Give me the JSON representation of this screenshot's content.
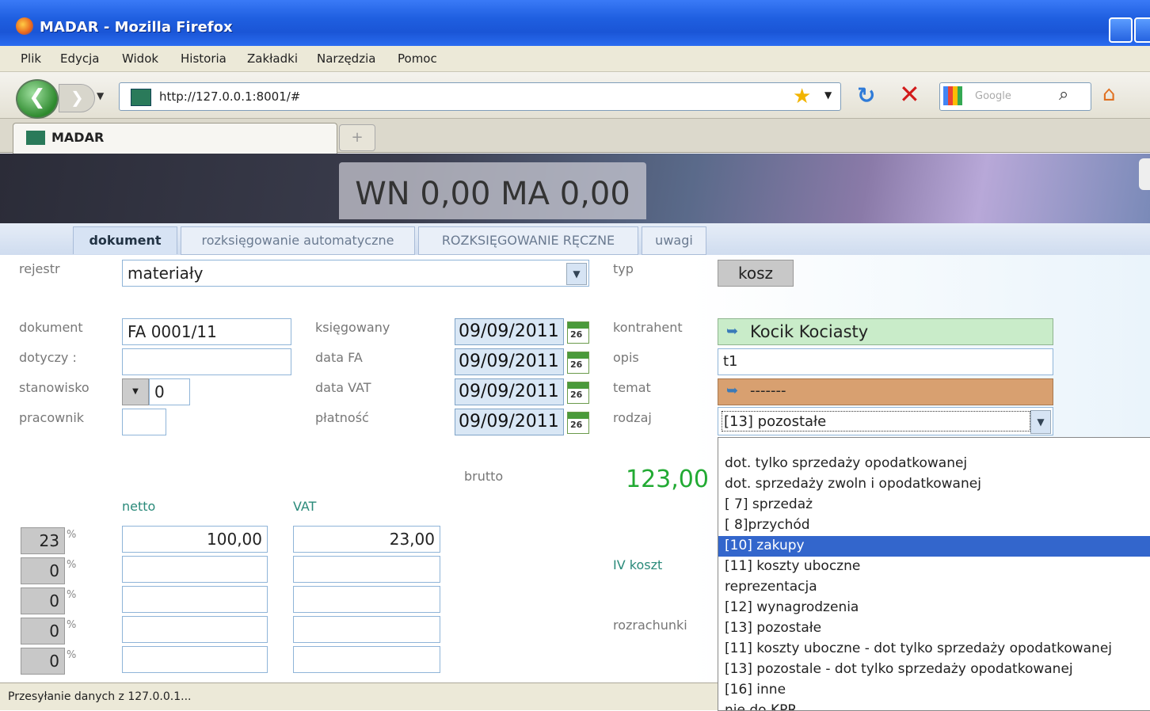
{
  "window": {
    "title": "MADAR - Mozilla Firefox"
  },
  "menu": [
    "Plik",
    "Edycja",
    "Widok",
    "Historia",
    "Zakładki",
    "Narzędzia",
    "Pomoc"
  ],
  "nav": {
    "url": "http://127.0.0.1:8001/#",
    "search_placeholder": "Google"
  },
  "browser_tab": {
    "label": "MADAR",
    "newtab": "+"
  },
  "header": {
    "balance": "WN 0,00 MA 0,00"
  },
  "app_tabs": [
    "dokument",
    "rozksięgowanie automatyczne",
    "ROZKSIĘGOWANIE RĘCZNE",
    "uwagi"
  ],
  "form": {
    "rejestr_label": "rejestr",
    "rejestr_value": "materiały",
    "typ_label": "typ",
    "typ_value": "kosz",
    "dokument_label": "dokument",
    "dokument_value": "FA 0001/11",
    "dotyczy_label": "dotyczy :",
    "dotyczy_value": "",
    "stanowisko_label": "stanowisko",
    "stanowisko_value": "0",
    "pracownik_label": "pracownik",
    "pracownik_value": "",
    "ksiegowany_label": "księgowany",
    "ksiegowany_value": "09/09/2011",
    "datafa_label": "data FA",
    "datafa_value": "09/09/2011",
    "datavat_label": "data VAT",
    "datavat_value": "09/09/2011",
    "platnosc_label": "płatność",
    "platnosc_value": "09/09/2011",
    "cal_day": "26",
    "kontrahent_label": "kontrahent",
    "kontrahent_value": "Kocik Kociasty",
    "opis_label": "opis",
    "opis_value": "t1",
    "temat_label": "temat",
    "temat_value": "-------",
    "rodzaj_label": "rodzaj",
    "rodzaj_value": "[13] pozostałe",
    "brutto_label": "brutto",
    "brutto_value": "123,00",
    "netto_label": "netto",
    "vat_label": "VAT",
    "iv_koszt_label": "IV koszt",
    "rozrachunki_label": "rozrachunki",
    "pct_sign": "%",
    "rows": [
      {
        "rate": "23",
        "netto": "100,00",
        "vat": "23,00"
      },
      {
        "rate": "0",
        "netto": "",
        "vat": ""
      },
      {
        "rate": "0",
        "netto": "",
        "vat": ""
      },
      {
        "rate": "0",
        "netto": "",
        "vat": ""
      },
      {
        "rate": "0",
        "netto": "",
        "vat": ""
      }
    ]
  },
  "rodzaj_options": [
    "dot. tylko sprzedaży opodatkowanej",
    "dot. sprzedaży zwoln i opodatkowanej",
    "[ 7] sprzedaż",
    "[ 8]przychód",
    "[10] zakupy",
    "[11] koszty uboczne",
    "reprezentacja",
    "[12] wynagrodzenia",
    "[13] pozostałe",
    "[11] koszty uboczne - dot tylko sprzedaży opodatkowanej",
    "[13] pozostale - dot tylko sprzedaży opodatkowanej",
    "[16] inne",
    "nie do KPR"
  ],
  "rodzaj_selected_index": 4,
  "status": {
    "text": "Przesyłanie danych z 127.0.0.1..."
  }
}
